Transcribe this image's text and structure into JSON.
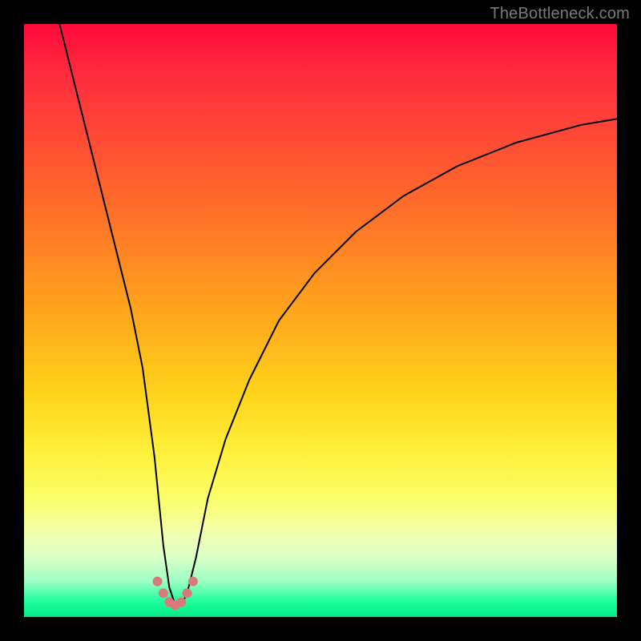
{
  "attribution": "TheBottleneck.com",
  "chart_data": {
    "type": "line",
    "title": "",
    "xlabel": "",
    "ylabel": "",
    "xlim": [
      0,
      100
    ],
    "ylim": [
      0,
      100
    ],
    "grid": false,
    "series": [
      {
        "name": "bottleneck-curve",
        "x": [
          6,
          8,
          10,
          12,
          14,
          16,
          18,
          20,
          22,
          23.5,
          24.5,
          25.5,
          26.5,
          27.5,
          29,
          31,
          34,
          38,
          43,
          49,
          56,
          64,
          73,
          83,
          94,
          100
        ],
        "values": [
          100,
          92,
          84,
          76,
          68,
          60,
          52,
          42,
          27,
          12,
          5,
          2,
          2,
          4,
          10,
          20,
          30,
          40,
          50,
          58,
          65,
          71,
          76,
          80,
          83,
          84
        ]
      }
    ],
    "markers": {
      "name": "trough-dots",
      "x": [
        22.5,
        23.5,
        24.5,
        25.5,
        26.5,
        27.5,
        28.5
      ],
      "values": [
        6,
        4,
        2.5,
        2,
        2.5,
        4,
        6
      ]
    }
  }
}
